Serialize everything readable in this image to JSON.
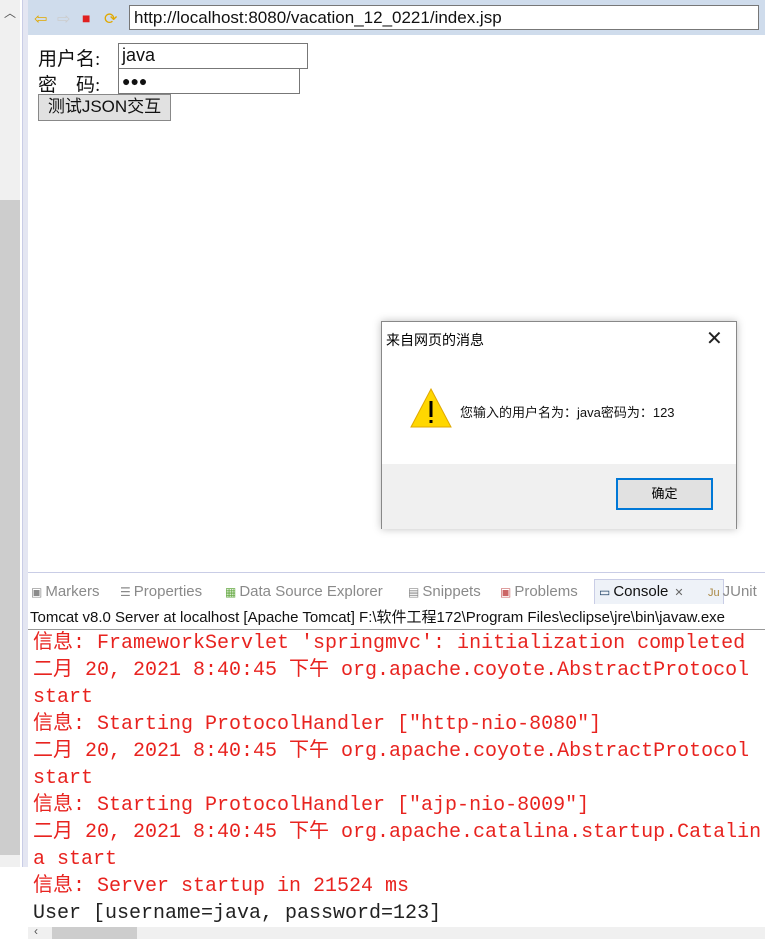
{
  "browser": {
    "url": "http://localhost:8080/vacation_12_0221/index.jsp",
    "nav": {
      "back": "⇦",
      "forward": "⇨",
      "stop": "■",
      "refresh": "⟳"
    }
  },
  "form": {
    "username_label": "用户名:",
    "username_value": "java",
    "password_label": "密　码:",
    "password_mask": "●●●",
    "submit_label": "测试JSON交互"
  },
  "dialog": {
    "title": "来自网页的消息",
    "message": "您输入的用户名为：java密码为：123",
    "ok_label": "确定",
    "icon": "warning-icon"
  },
  "panel": {
    "tabs": [
      {
        "label": "Markers",
        "icon": "markers-icon"
      },
      {
        "label": "Properties",
        "icon": "properties-icon"
      },
      {
        "label": "Data Source Explorer",
        "icon": "data-source-icon"
      },
      {
        "label": "Snippets",
        "icon": "snippets-icon"
      },
      {
        "label": "Problems",
        "icon": "problems-icon"
      },
      {
        "label": "Console",
        "icon": "console-icon",
        "active": true
      },
      {
        "label": "JUnit",
        "icon": "junit-icon"
      }
    ],
    "console_title": "Tomcat v8.0 Server at localhost [Apache Tomcat] F:\\软件工程172\\Program Files\\eclipse\\jre\\bin\\javaw.exe",
    "lines": [
      {
        "text": "信息: FrameworkServlet 'springmvc': initialization completed",
        "color": "#e8231f"
      },
      {
        "text": "二月 20, 2021 8:40:45 下午 org.apache.coyote.AbstractProtocol start",
        "color": "#e8231f"
      },
      {
        "text": "信息: Starting ProtocolHandler [\"http-nio-8080\"]",
        "color": "#e8231f"
      },
      {
        "text": "二月 20, 2021 8:40:45 下午 org.apache.coyote.AbstractProtocol start",
        "color": "#e8231f"
      },
      {
        "text": "信息: Starting ProtocolHandler [\"ajp-nio-8009\"]",
        "color": "#e8231f"
      },
      {
        "text": "二月 20, 2021 8:40:45 下午 org.apache.catalina.startup.Catalina start",
        "color": "#e8231f"
      },
      {
        "text": "信息: Server startup in 21524 ms",
        "color": "#e8231f"
      },
      {
        "text": "User [username=java, password=123]",
        "color": "#222222"
      }
    ]
  }
}
